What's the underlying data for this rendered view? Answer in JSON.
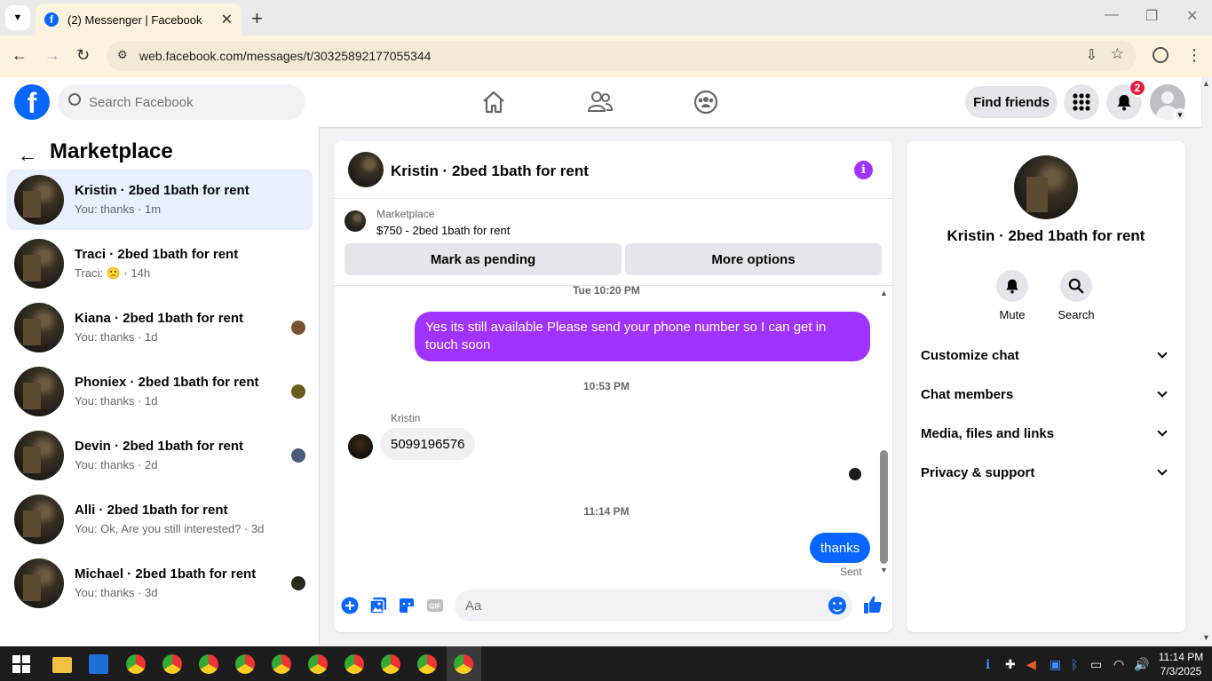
{
  "browser": {
    "tab_title": "(2) Messenger | Facebook",
    "url": "web.facebook.com/messages/t/30325892177055344"
  },
  "fb": {
    "search_placeholder": "Search Facebook",
    "find_friends": "Find friends",
    "notification_count": "2"
  },
  "sidebar": {
    "title": "Marketplace",
    "conversations": [
      {
        "name": "Kristin · 2bed 1bath for rent",
        "snippet": "You: thanks · 1m",
        "active": true
      },
      {
        "name": "Traci · 2bed 1bath for rent",
        "snippet": "Traci: 🙁 · 14h"
      },
      {
        "name": "Kiana · 2bed 1bath for rent",
        "snippet": "You: thanks · 1d"
      },
      {
        "name": "Phoniex · 2bed 1bath for rent",
        "snippet": "You: thanks · 1d"
      },
      {
        "name": "Devin · 2bed 1bath for rent",
        "snippet": "You: thanks · 2d"
      },
      {
        "name": "Alli · 2bed 1bath for rent",
        "snippet": "You: Ok, Are you still interested? · 3d"
      },
      {
        "name": "Michael · 2bed 1bath for rent",
        "snippet": "You: thanks · 3d"
      }
    ]
  },
  "chat": {
    "title": "Kristin · 2bed 1bath for rent",
    "marketplace_label": "Marketplace",
    "listing": "$750 - 2bed 1bath for rent",
    "mark_pending": "Mark as pending",
    "more_options": "More options",
    "messages": [
      {
        "time": "Tue 10:20 PM"
      },
      {
        "from": "me",
        "text": "Yes its still available Please send your phone number so I can get in touch soon"
      },
      {
        "time": "10:53 PM"
      },
      {
        "sender": "Kristin",
        "text": "5099196576"
      },
      {
        "time": "11:14 PM"
      },
      {
        "from": "me",
        "text": "thanks"
      }
    ],
    "status": "Sent",
    "composer_placeholder": "Aa"
  },
  "info": {
    "name": "Kristin · 2bed 1bath for rent",
    "mute": "Mute",
    "search": "Search",
    "sections": [
      "Customize chat",
      "Chat members",
      "Media, files and links",
      "Privacy & support"
    ]
  },
  "taskbar": {
    "time": "11:14 PM",
    "date": "7/3/2025"
  },
  "colors": {
    "fb_blue": "#0866ff",
    "outgoing_purple": "#a033ff",
    "outgoing_blue": "#0866ff",
    "badge_red": "#e41e3f"
  }
}
